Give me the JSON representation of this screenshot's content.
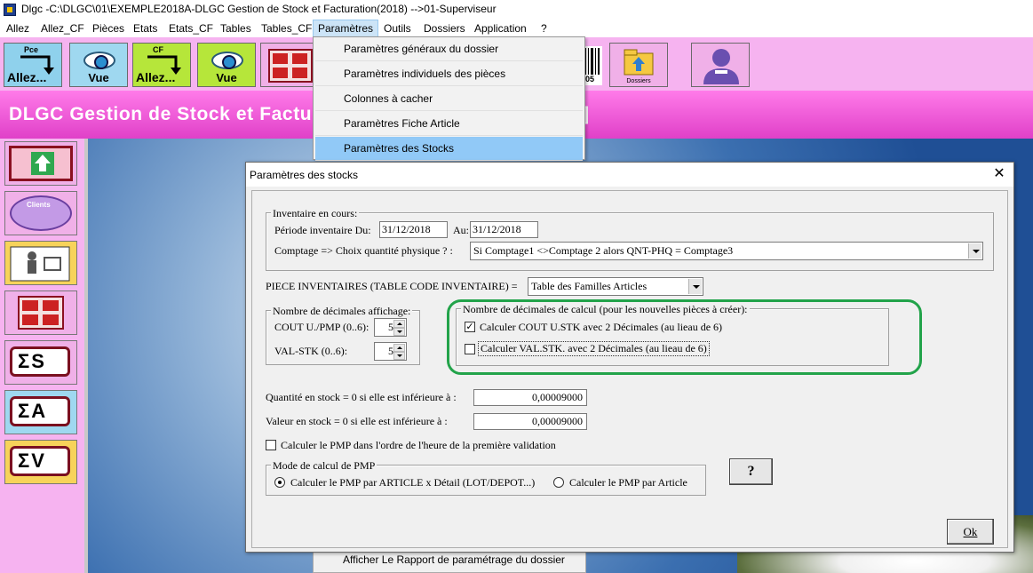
{
  "window": {
    "title": "Dlgc -C:\\DLGC\\01\\EXEMPLE2018A-DLGC Gestion de Stock et Facturation(2018) -->01-Superviseur"
  },
  "menubar": [
    {
      "label": "Allez"
    },
    {
      "label": "Allez_CF"
    },
    {
      "label": "Pièces"
    },
    {
      "label": "Etats"
    },
    {
      "label": "Etats_CF"
    },
    {
      "label": "Tables"
    },
    {
      "label": "Tables_CF"
    },
    {
      "label": "Paramètres"
    },
    {
      "label": "Outils"
    },
    {
      "label": "Dossiers"
    },
    {
      "label": "Application"
    },
    {
      "label": "?"
    }
  ],
  "toolbar": {
    "pce_sup": "Pce",
    "pce_cap": "Allez...",
    "vue1_cap": "Vue",
    "cf_sup": "CF",
    "cf_cap": "Allez...",
    "vue2_cap": "Vue",
    "dossiers_label": "Dossiers",
    "barcode_digits": "05"
  },
  "banner": {
    "text": "DLGC Gestion de Stock et Facturati",
    "text_tail": "r]"
  },
  "sidebar": {
    "clients_label": "Clients",
    "sigma_s": "ΣS",
    "sigma_a": "ΣA",
    "sigma_v": "ΣV"
  },
  "dropdown": {
    "items": [
      {
        "label": "Paramètres généraux du dossier"
      },
      {
        "label": "Paramètres individuels des pièces"
      },
      {
        "label": "Colonnes à cacher"
      },
      {
        "label": "Paramètres Fiche Article"
      },
      {
        "label": "Paramètres des Stocks"
      }
    ]
  },
  "background": {
    "partial_text": "Afficher Le Rapport de paramétrage du dossier"
  },
  "dialog": {
    "title": "Paramètres des stocks",
    "close_glyph": "✕",
    "inventaire": {
      "legend": "Inventaire en cours:",
      "periode_label": "Période inventaire Du:",
      "periode_du": "31/12/2018",
      "au_label": "Au:",
      "periode_au": "31/12/2018",
      "comptage_label": "Comptage => Choix quantité physique ? :",
      "comptage_value": "Si Comptage1 <>Comptage 2 alors QNT-PHQ = Comptage3"
    },
    "piece_inv_label": "PIECE INVENTAIRES (TABLE CODE INVENTAIRE)  =",
    "piece_inv_value": "Table des Familles Articles",
    "decimales_affichage": {
      "legend": "Nombre de décimales affichage:",
      "cout_label": "COUT U./PMP (0..6):",
      "cout_value": "5",
      "val_label": "VAL-STK (0..6):",
      "val_value": "5"
    },
    "decimales_calcul": {
      "legend": "Nombre de décimales de calcul (pour les nouvelles pièces à créer):",
      "cout_label": "Calculer COUT U.STK avec 2 Décimales (au lieau de 6)",
      "cout_checked": true,
      "val_label": "Calculer VAL.STK. avec 2 Décimales (au lieau de 6)",
      "val_checked": false
    },
    "quantite_label": "Quantité en stock = 0 si elle est inférieure à :",
    "quantite_value": "0,00009000",
    "valeur_label": "Valeur en stock  = 0 si elle est inférieure à :",
    "valeur_value": "0,00009000",
    "pmp_ordre_label": "Calculer le PMP dans l'ordre de l'heure de la première validation",
    "pmp_ordre_checked": false,
    "mode_pmp": {
      "legend": "Mode de calcul de PMP",
      "option1": "Calculer le PMP par ARTICLE x Détail (LOT/DEPOT...)",
      "option2": "Calculer le PMP par Article",
      "selected": 1
    },
    "help_button": "?",
    "ok_button": "Ok"
  },
  "colors": {
    "pink": "#f6b3f0",
    "banner": "#e040c8",
    "highlight_green": "#22a34a",
    "menu_highlight": "#91c9f7"
  }
}
